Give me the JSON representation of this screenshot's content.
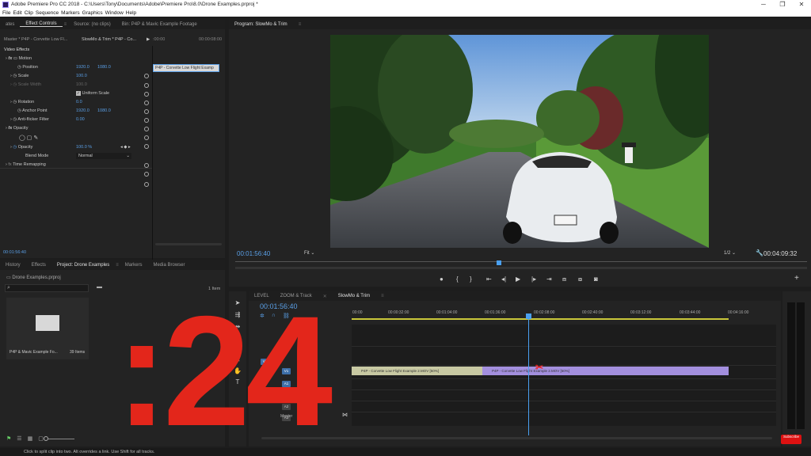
{
  "window": {
    "title": "Adobe Premiere Pro CC 2018 - C:\\Users\\Tony\\Documents\\Adobe\\Premiere Pro\\8.0\\Drone Examples.prproj *",
    "min": "─",
    "max": "❐",
    "close": "✕"
  },
  "menu": [
    "File",
    "Edit",
    "Clip",
    "Sequence",
    "Markers",
    "Graphics",
    "Window",
    "Help"
  ],
  "source_tabs": {
    "t0": "ates",
    "t1": "Effect Controls",
    "t2": "Source: (no clips)",
    "t3": "Bin: P4P & Mavic Example Footage"
  },
  "effect_controls": {
    "master": "Master * P4P - Corvette Low Fl...",
    "seq": "SlowMo & Trim * P4P - Co...",
    "tc0": ":00:00",
    "tc1": "00:00:08:00",
    "clip_label": "P4P - Corvette Low Flight Examp",
    "video_effects": "Video Effects",
    "motion": "Motion",
    "position": "Position",
    "pos_x": "1920.0",
    "pos_y": "1080.0",
    "scale": "Scale",
    "scale_v": "100.0",
    "scale_w": "Scale Width",
    "scale_w_v": "100.0",
    "uniform": "Uniform Scale",
    "rotation": "Rotation",
    "rot_v": "0.0",
    "anchor": "Anchor Point",
    "anc_x": "1920.0",
    "anc_y": "1080.0",
    "flicker": "Anti-flicker Filter",
    "flicker_v": "0.00",
    "opacity": "Opacity",
    "opacity_p": "Opacity",
    "opacity_v": "100.0 %",
    "blend": "Blend Mode",
    "blend_v": "Normal",
    "remap": "Time Remapping",
    "timecode": "00:01:56:40"
  },
  "program": {
    "tab": "Program: SlowMo & Trim",
    "timecode": "00:01:56:40",
    "fit": "Fit",
    "res": "1/2",
    "duration": "00:04:09:32"
  },
  "project": {
    "tabs": [
      "History",
      "Effects",
      "Project: Drone Examples",
      "Markers",
      "Media Browser"
    ],
    "file": "Drone Examples.prproj",
    "items": "1 Item",
    "bin_name": "P4P & Mavic Example Fo...",
    "bin_count": "39 Items"
  },
  "timeline": {
    "tabs": [
      "LEVEL",
      "ZOOM & Track",
      "SlowMo & Trim"
    ],
    "timecode": "00:01:56:40",
    "ruler": [
      "00:00",
      "00:00:32:00",
      "00:01:04:00",
      "00:01:36:00",
      "00:02:08:00",
      "00:02:40:00",
      "00:03:12:00",
      "00:03:44:00",
      "00:04:16:00"
    ],
    "tracks": [
      "V1",
      "V1",
      "A1",
      "A1",
      "A2",
      "A3"
    ],
    "master": "Master",
    "clip1": "P4P - Corvette Low Flight Example 2.MOV [50%]",
    "clip2": "P4P - Corvette Low Flight Example 2.MOV [50%]"
  },
  "overlay": {
    "text": ":24",
    "color": "#e3261b"
  },
  "status": "Click to split clip into two. Alt overrides a link. Use Shift for all tracks.",
  "subscribe": "Subscribe",
  "colors": {
    "accent": "#5a9fe6",
    "clip_green": "#c8c9a3",
    "clip_purple": "#a38fde",
    "playhead": "#4aa0f0"
  }
}
